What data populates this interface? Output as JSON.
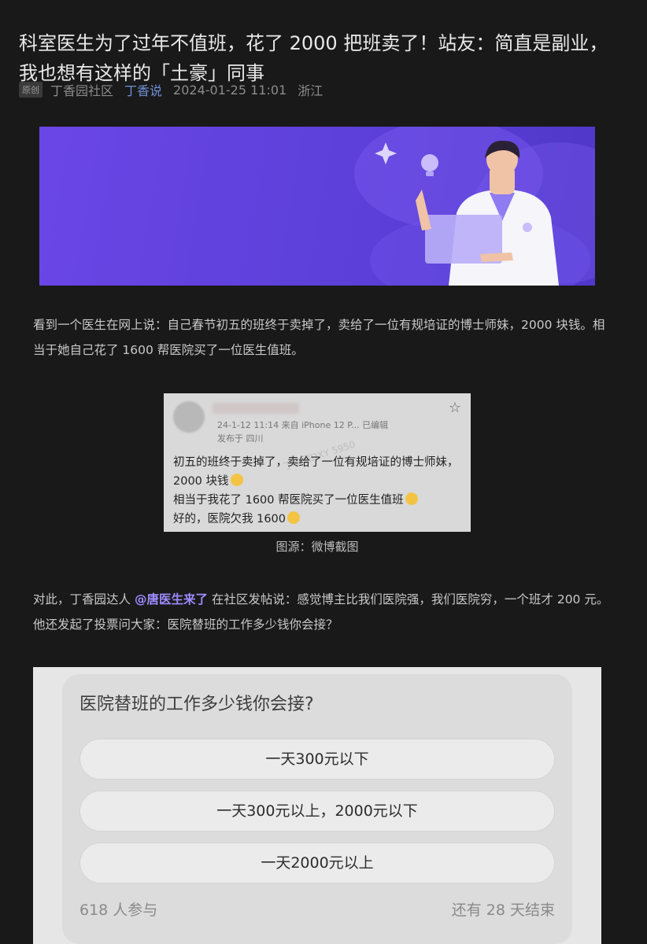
{
  "article": {
    "title": "科室医生为了过年不值班，花了 2000 把班卖了！站友：简直是副业，我也想有这样的「土豪」同事",
    "badge": "原创",
    "source": "丁香园社区",
    "author": "丁香说",
    "date": "2024-01-25 11:01",
    "location": "浙江"
  },
  "paragraph1": "看到一个医生在网上说：自己春节初五的班终于卖掉了，卖给了一位有规培证的博士师妹，2000 块钱。相当于她自己花了 1600 帮医院买了一位医生值班。",
  "weibo": {
    "meta_time": "24-1-12 11:14  来自 iPhone 12 P...  已编辑",
    "meta_loc": "发布于 四川",
    "watermark": "丁香园DXY 5950",
    "line1": "初五的班终于卖掉了，卖给了一位有规培证的博士师妹，2000 块钱",
    "line2": "相当于我花了 1600 帮医院买了一位医生值班",
    "line3": "好的，医院欠我 1600",
    "star_icon": "star-outline-icon"
  },
  "caption": "图源：微博截图",
  "paragraph2": {
    "before": "对此，丁香园达人",
    "mention": "@唐医生来了",
    "after": "在社区发帖说：感觉博主比我们医院强，我们医院穷，一个班才 200 元。他还发起了投票问大家：医院替班的工作多少钱你会接？"
  },
  "poll": {
    "question": "医院替班的工作多少钱你会接?",
    "options": [
      "一天300元以下",
      "一天300元以上，2000元以下",
      "一天2000元以上"
    ],
    "participants": "618 人参与",
    "remaining": "还有 28 天结束"
  },
  "colors": {
    "banner_purple": "#5b3fd8",
    "mention": "#9f8cff",
    "author_link": "#6f8fd6"
  }
}
